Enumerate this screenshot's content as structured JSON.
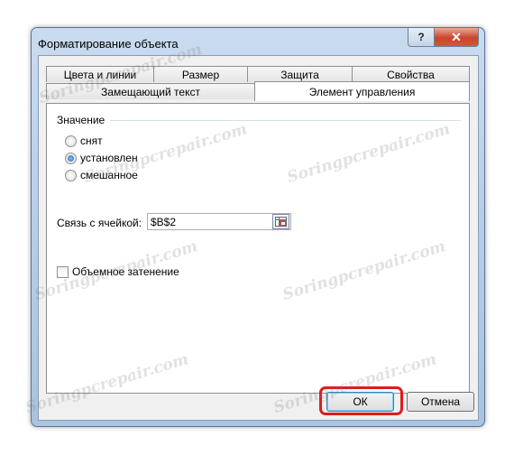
{
  "window": {
    "title": "Форматирование объекта",
    "help_label": "?",
    "close_label": "✕"
  },
  "tabs": {
    "row_back": [
      "Цвета и линии",
      "Размер",
      "Защита",
      "Свойства"
    ],
    "row_front": [
      "Замещающий текст",
      "Элемент управления"
    ],
    "active": "Элемент управления"
  },
  "control": {
    "group_label": "Значение",
    "options": [
      {
        "label": "снят",
        "checked": false
      },
      {
        "label": "установлен",
        "checked": true
      },
      {
        "label": "смешанное",
        "checked": false
      }
    ],
    "link_label": "Связь с ячейкой:",
    "link_value": "$B$2",
    "shading_label": "Объемное затенение",
    "shading_checked": false
  },
  "buttons": {
    "ok": "ОК",
    "cancel": "Отмена"
  },
  "watermark": "Soringpcrepair.com"
}
